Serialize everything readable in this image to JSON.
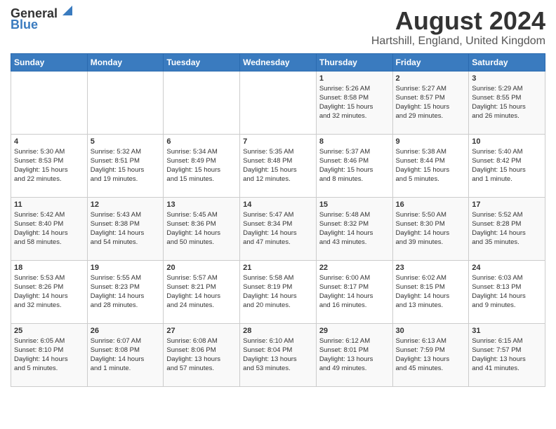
{
  "header": {
    "logo_general": "General",
    "logo_blue": "Blue",
    "title": "August 2024",
    "subtitle": "Hartshill, England, United Kingdom"
  },
  "weekdays": [
    "Sunday",
    "Monday",
    "Tuesday",
    "Wednesday",
    "Thursday",
    "Friday",
    "Saturday"
  ],
  "weeks": [
    [
      {
        "day": "",
        "info": ""
      },
      {
        "day": "",
        "info": ""
      },
      {
        "day": "",
        "info": ""
      },
      {
        "day": "",
        "info": ""
      },
      {
        "day": "1",
        "info": "Sunrise: 5:26 AM\nSunset: 8:58 PM\nDaylight: 15 hours\nand 32 minutes."
      },
      {
        "day": "2",
        "info": "Sunrise: 5:27 AM\nSunset: 8:57 PM\nDaylight: 15 hours\nand 29 minutes."
      },
      {
        "day": "3",
        "info": "Sunrise: 5:29 AM\nSunset: 8:55 PM\nDaylight: 15 hours\nand 26 minutes."
      }
    ],
    [
      {
        "day": "4",
        "info": "Sunrise: 5:30 AM\nSunset: 8:53 PM\nDaylight: 15 hours\nand 22 minutes."
      },
      {
        "day": "5",
        "info": "Sunrise: 5:32 AM\nSunset: 8:51 PM\nDaylight: 15 hours\nand 19 minutes."
      },
      {
        "day": "6",
        "info": "Sunrise: 5:34 AM\nSunset: 8:49 PM\nDaylight: 15 hours\nand 15 minutes."
      },
      {
        "day": "7",
        "info": "Sunrise: 5:35 AM\nSunset: 8:48 PM\nDaylight: 15 hours\nand 12 minutes."
      },
      {
        "day": "8",
        "info": "Sunrise: 5:37 AM\nSunset: 8:46 PM\nDaylight: 15 hours\nand 8 minutes."
      },
      {
        "day": "9",
        "info": "Sunrise: 5:38 AM\nSunset: 8:44 PM\nDaylight: 15 hours\nand 5 minutes."
      },
      {
        "day": "10",
        "info": "Sunrise: 5:40 AM\nSunset: 8:42 PM\nDaylight: 15 hours\nand 1 minute."
      }
    ],
    [
      {
        "day": "11",
        "info": "Sunrise: 5:42 AM\nSunset: 8:40 PM\nDaylight: 14 hours\nand 58 minutes."
      },
      {
        "day": "12",
        "info": "Sunrise: 5:43 AM\nSunset: 8:38 PM\nDaylight: 14 hours\nand 54 minutes."
      },
      {
        "day": "13",
        "info": "Sunrise: 5:45 AM\nSunset: 8:36 PM\nDaylight: 14 hours\nand 50 minutes."
      },
      {
        "day": "14",
        "info": "Sunrise: 5:47 AM\nSunset: 8:34 PM\nDaylight: 14 hours\nand 47 minutes."
      },
      {
        "day": "15",
        "info": "Sunrise: 5:48 AM\nSunset: 8:32 PM\nDaylight: 14 hours\nand 43 minutes."
      },
      {
        "day": "16",
        "info": "Sunrise: 5:50 AM\nSunset: 8:30 PM\nDaylight: 14 hours\nand 39 minutes."
      },
      {
        "day": "17",
        "info": "Sunrise: 5:52 AM\nSunset: 8:28 PM\nDaylight: 14 hours\nand 35 minutes."
      }
    ],
    [
      {
        "day": "18",
        "info": "Sunrise: 5:53 AM\nSunset: 8:26 PM\nDaylight: 14 hours\nand 32 minutes."
      },
      {
        "day": "19",
        "info": "Sunrise: 5:55 AM\nSunset: 8:23 PM\nDaylight: 14 hours\nand 28 minutes."
      },
      {
        "day": "20",
        "info": "Sunrise: 5:57 AM\nSunset: 8:21 PM\nDaylight: 14 hours\nand 24 minutes."
      },
      {
        "day": "21",
        "info": "Sunrise: 5:58 AM\nSunset: 8:19 PM\nDaylight: 14 hours\nand 20 minutes."
      },
      {
        "day": "22",
        "info": "Sunrise: 6:00 AM\nSunset: 8:17 PM\nDaylight: 14 hours\nand 16 minutes."
      },
      {
        "day": "23",
        "info": "Sunrise: 6:02 AM\nSunset: 8:15 PM\nDaylight: 14 hours\nand 13 minutes."
      },
      {
        "day": "24",
        "info": "Sunrise: 6:03 AM\nSunset: 8:13 PM\nDaylight: 14 hours\nand 9 minutes."
      }
    ],
    [
      {
        "day": "25",
        "info": "Sunrise: 6:05 AM\nSunset: 8:10 PM\nDaylight: 14 hours\nand 5 minutes."
      },
      {
        "day": "26",
        "info": "Sunrise: 6:07 AM\nSunset: 8:08 PM\nDaylight: 14 hours\nand 1 minute."
      },
      {
        "day": "27",
        "info": "Sunrise: 6:08 AM\nSunset: 8:06 PM\nDaylight: 13 hours\nand 57 minutes."
      },
      {
        "day": "28",
        "info": "Sunrise: 6:10 AM\nSunset: 8:04 PM\nDaylight: 13 hours\nand 53 minutes."
      },
      {
        "day": "29",
        "info": "Sunrise: 6:12 AM\nSunset: 8:01 PM\nDaylight: 13 hours\nand 49 minutes."
      },
      {
        "day": "30",
        "info": "Sunrise: 6:13 AM\nSunset: 7:59 PM\nDaylight: 13 hours\nand 45 minutes."
      },
      {
        "day": "31",
        "info": "Sunrise: 6:15 AM\nSunset: 7:57 PM\nDaylight: 13 hours\nand 41 minutes."
      }
    ]
  ]
}
